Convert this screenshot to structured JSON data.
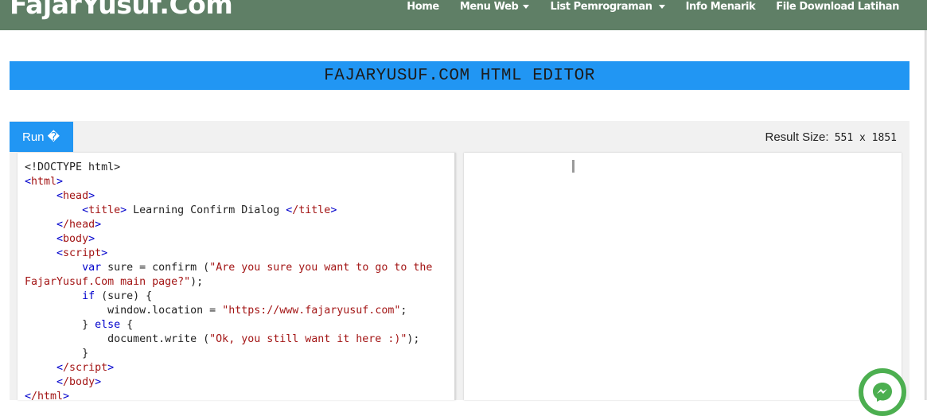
{
  "navbar": {
    "brand": "FajarYusuf.Com",
    "items": [
      {
        "label": "Home",
        "dropdown": false
      },
      {
        "label": "Menu Web",
        "dropdown": true
      },
      {
        "label": "List Pemrograman",
        "dropdown": true
      },
      {
        "label": "Info Menarik",
        "dropdown": false
      },
      {
        "label": "File Download Latihan",
        "dropdown": false
      }
    ]
  },
  "editor": {
    "title": "FAJARYUSUF.COM HTML EDITOR",
    "run_label": "Run �",
    "result_size_label": "Result Size:",
    "result_size_value": "551 x 1851"
  },
  "code": {
    "l1": "<!DOCTYPE html>",
    "l2_tag": "html",
    "l3_tag": "head",
    "l4_open": "title",
    "l4_text": " Learning Confirm Dialog ",
    "l4_close": "/title",
    "l5_tag": "/head",
    "l6_tag": "body",
    "l7_tag": "script",
    "l8_var": "var",
    "l8_plain": " sure = confirm (",
    "l8_str": "\"Are you sure you want to go to the FajarYusuf.Com main page?\"",
    "l8_end": ");",
    "l9_kw": "if",
    "l9_plain": " (sure) {",
    "l10_plain": "window.location = ",
    "l10_str": "\"https://www.fajaryusuf.com\"",
    "l10_end": ";",
    "l11_plain1": "} ",
    "l11_kw": "else",
    "l11_plain2": " {",
    "l12_plain": "document.write (",
    "l12_str": "\"Ok, you still want it here :)\"",
    "l12_end": ");",
    "l13_plain": "}",
    "l14_tag": "/script",
    "l15_tag": "/body",
    "l16_tag": "/html"
  },
  "colors": {
    "navbar": "#5f7f66",
    "accent": "#2196f3",
    "messenger": "#4caf50"
  }
}
